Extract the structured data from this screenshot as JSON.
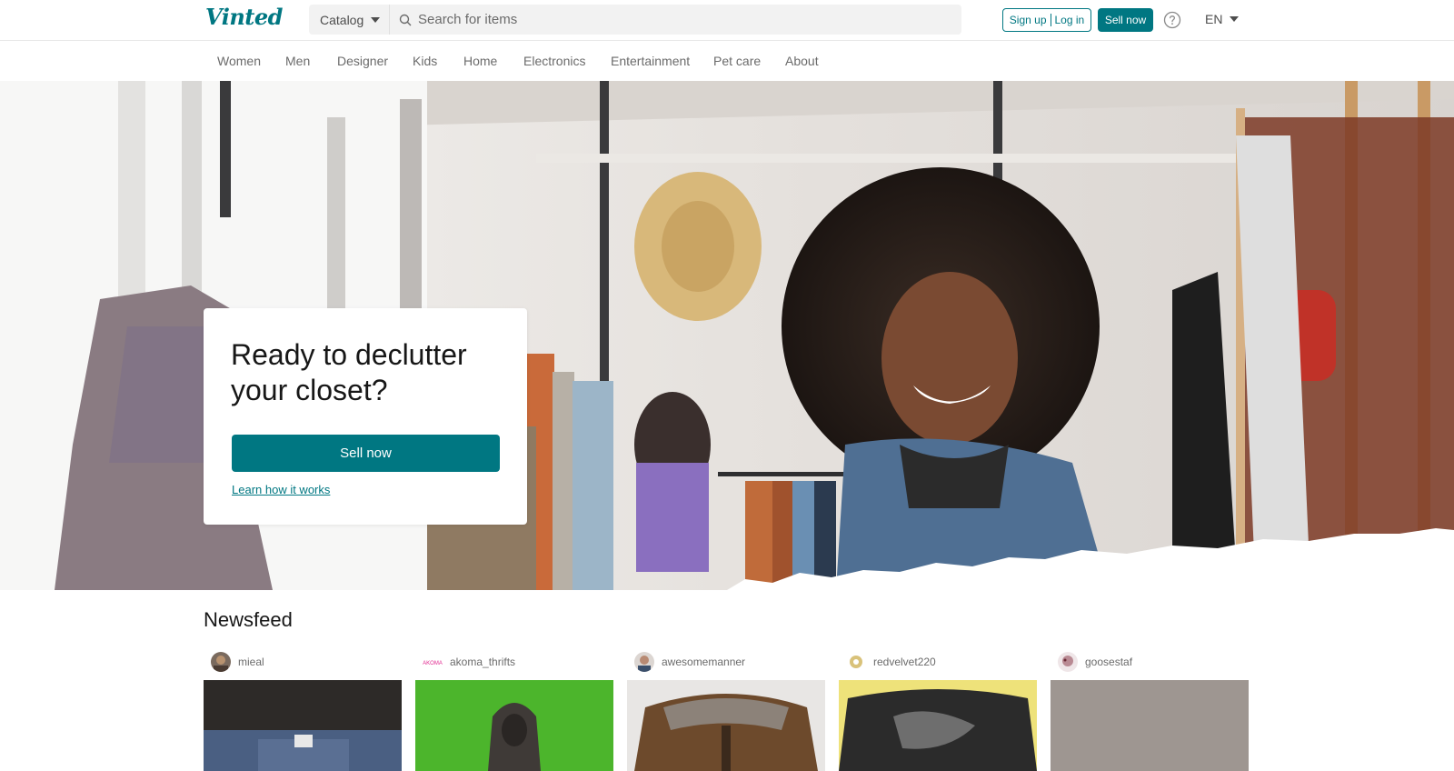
{
  "header": {
    "logo": "Vinted",
    "catalog_label": "Catalog",
    "search_placeholder": "Search for items",
    "signup_label": "Sign up",
    "login_label": "Log in",
    "sell_label": "Sell now",
    "language": "EN"
  },
  "nav": {
    "items": [
      "Women",
      "Men",
      "Designer",
      "Kids",
      "Home",
      "Electronics",
      "Entertainment",
      "Pet care",
      "About"
    ]
  },
  "hero": {
    "title": "Ready to declutter your closet?",
    "sell_button": "Sell now",
    "learn_link": "Learn how it works"
  },
  "newsfeed": {
    "title": "Newsfeed",
    "items": [
      {
        "user": "mieal"
      },
      {
        "user": "akoma_thrifts",
        "avatar_text": "AKOMA"
      },
      {
        "user": "awesomemanner"
      },
      {
        "user": "redvelvet220"
      },
      {
        "user": "goosestaf"
      }
    ]
  },
  "colors": {
    "brand": "#007782",
    "text": "#171717",
    "muted": "#6b6b6b"
  }
}
